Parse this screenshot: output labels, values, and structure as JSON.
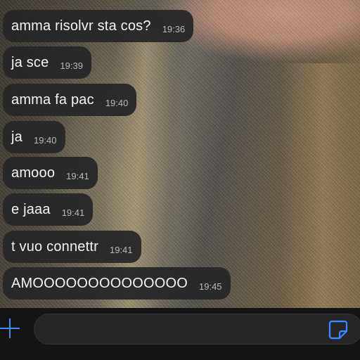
{
  "messages": [
    {
      "text": "amma risolvr sta cos?",
      "time": "19:36"
    },
    {
      "text": "ja sce",
      "time": "19:39"
    },
    {
      "text": "amma fa pac",
      "time": "19:40"
    },
    {
      "text": "ja",
      "time": "19:40"
    },
    {
      "text": "amooo",
      "time": "19:41"
    },
    {
      "text": "e jaaa",
      "time": "19:41"
    },
    {
      "text": "t vuo connettr",
      "time": "19:41"
    },
    {
      "text": "AMOOOOOOOOOOOOOO",
      "time": "19:45"
    }
  ],
  "composer": {
    "placeholder": "",
    "attach_icon": "plus-icon",
    "sticker_icon": "sticker-icon",
    "accent_color": "#3c8cff"
  }
}
